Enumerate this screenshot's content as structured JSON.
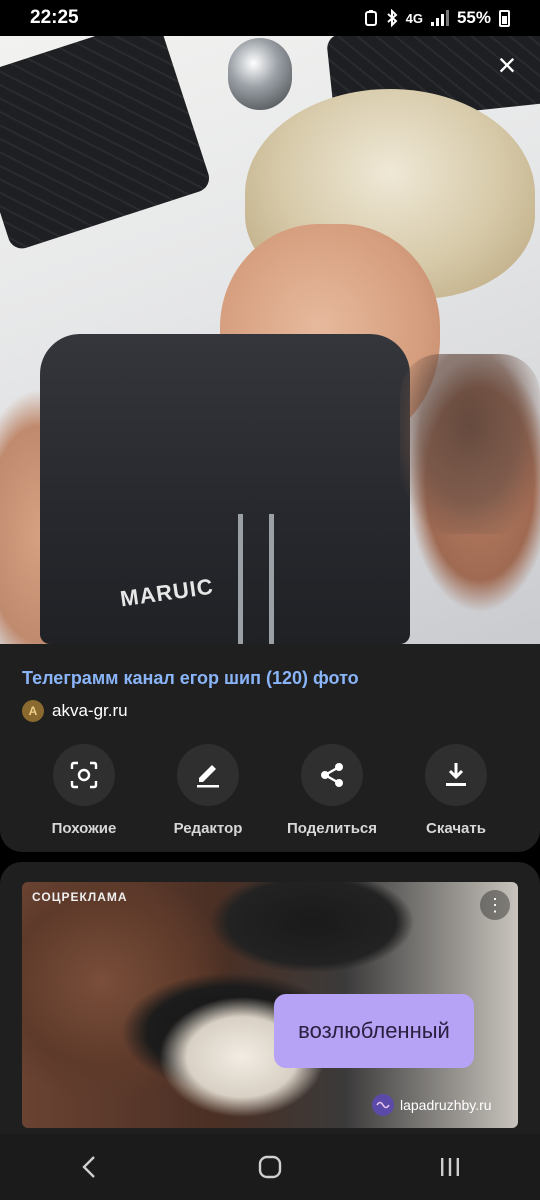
{
  "status_bar": {
    "time": "22:25",
    "network": "4G",
    "battery": "55%"
  },
  "image": {
    "close_label": "×",
    "vest_text": "MARUIC"
  },
  "result": {
    "title": "Телеграмм канал егор шип (120) фото",
    "source": "akva-gr.ru",
    "favicon_letter": "A"
  },
  "actions": [
    {
      "label": "Похожие",
      "icon": "lens-search-icon"
    },
    {
      "label": "Редактор",
      "icon": "pencil-icon"
    },
    {
      "label": "Поделиться",
      "icon": "share-icon"
    },
    {
      "label": "Скачать",
      "icon": "download-icon"
    }
  ],
  "ad": {
    "tag": "СОЦРЕКЛАМА",
    "bubble_text": "возлюбленный",
    "domain": "lapadruzhby.ru",
    "menu_glyph": "⋮"
  }
}
